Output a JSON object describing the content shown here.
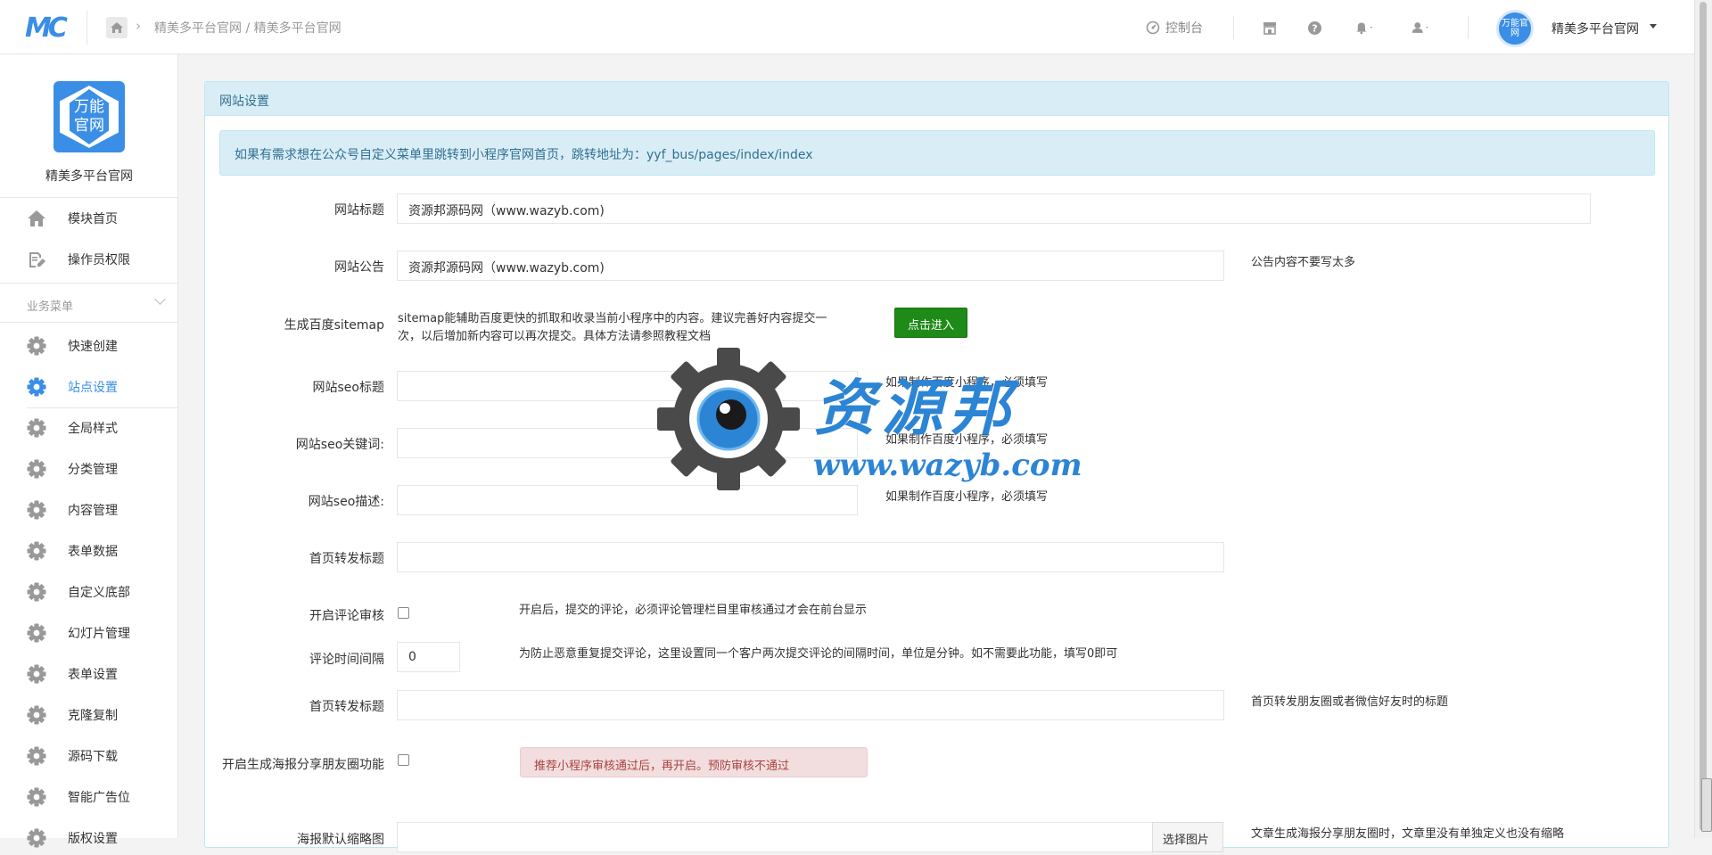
{
  "topbar": {
    "logo": "MC",
    "breadcrumb": "精美多平台官网 / 精美多平台官网",
    "dashboard_label": "控制台",
    "avatar_text": "万能官网",
    "username": "精美多平台官网"
  },
  "sidebar": {
    "brand_logo_text": "万能官网",
    "brand_name": "精美多平台官网",
    "top_items": [
      {
        "label": "模块首页",
        "icon": "home-icon"
      },
      {
        "label": "操作员权限",
        "icon": "edit-icon"
      }
    ],
    "section_label": "业务菜单",
    "menu_items": [
      {
        "label": "快速创建",
        "icon": "gear-icon"
      },
      {
        "label": "站点设置",
        "icon": "gear-icon"
      },
      {
        "label": "全局样式",
        "icon": "gear-icon"
      },
      {
        "label": "分类管理",
        "icon": "gear-icon"
      },
      {
        "label": "内容管理",
        "icon": "gear-icon"
      },
      {
        "label": "表单数据",
        "icon": "gear-icon"
      },
      {
        "label": "自定义底部",
        "icon": "gear-icon"
      },
      {
        "label": "幻灯片管理",
        "icon": "gear-icon"
      },
      {
        "label": "表单设置",
        "icon": "gear-icon"
      },
      {
        "label": "克隆复制",
        "icon": "gear-icon"
      },
      {
        "label": "源码下载",
        "icon": "gear-icon"
      },
      {
        "label": "智能广告位",
        "icon": "gear-icon"
      },
      {
        "label": "版权设置",
        "icon": "gear-icon"
      }
    ]
  },
  "panel": {
    "title": "网站设置",
    "info": "如果有需求想在公众号自定义菜单里跳转到小程序官网首页，跳转地址为：yyf_bus/pages/index/index"
  },
  "form": {
    "site_title": {
      "label": "网站标题",
      "value": "资源邦源码网（www.wazyb.com)"
    },
    "site_notice": {
      "label": "网站公告",
      "value": "资源邦源码网（www.wazyb.com)",
      "help": "公告内容不要写太多"
    },
    "sitemap": {
      "label": "生成百度sitemap",
      "desc_line1": "sitemap能辅助百度更快的抓取和收录当前小程序中的内容。建议完善好内容提交一",
      "desc_line2": "次，以后增加新内容可以再次提交。具体方法请参照教程文档",
      "button": "点击进入"
    },
    "seo_title": {
      "label": "网站seo标题",
      "value": "",
      "help": "如果制作百度小程序，必须填写"
    },
    "seo_keywords": {
      "label": "网站seo关键词:",
      "value": "",
      "help": "如果制作百度小程序，必须填写"
    },
    "seo_desc": {
      "label": "网站seo描述:",
      "value": "",
      "help": "如果制作百度小程序，必须填写"
    },
    "share_title": {
      "label": "首页转发标题",
      "value": ""
    },
    "comment_review": {
      "label": "开启评论审核",
      "help": "开启后，提交的评论，必须评论管理栏目里审核通过才会在前台显示"
    },
    "comment_interval": {
      "label": "评论时间间隔",
      "value": "0",
      "help": "为防止恶意重复提交评论，这里设置同一个客户两次提交评论的间隔时间，单位是分钟。如不需要此功能，填写0即可"
    },
    "share_title2": {
      "label": "首页转发标题",
      "value": "",
      "help": "首页转发朋友圈或者微信好友时的标题"
    },
    "poster_share": {
      "label": "开启生成海报分享朋友圈功能",
      "warning": "推荐小程序审核通过后，再开启。预防审核不通过"
    },
    "poster_thumb": {
      "label": "海报默认缩略图",
      "button": "选择图片",
      "help": "文章生成海报分享朋友圈时，文章里没有单独定义也没有缩略"
    }
  },
  "watermark": {
    "text_cn": "资源邦",
    "text_url": "www.wazyb.com"
  }
}
